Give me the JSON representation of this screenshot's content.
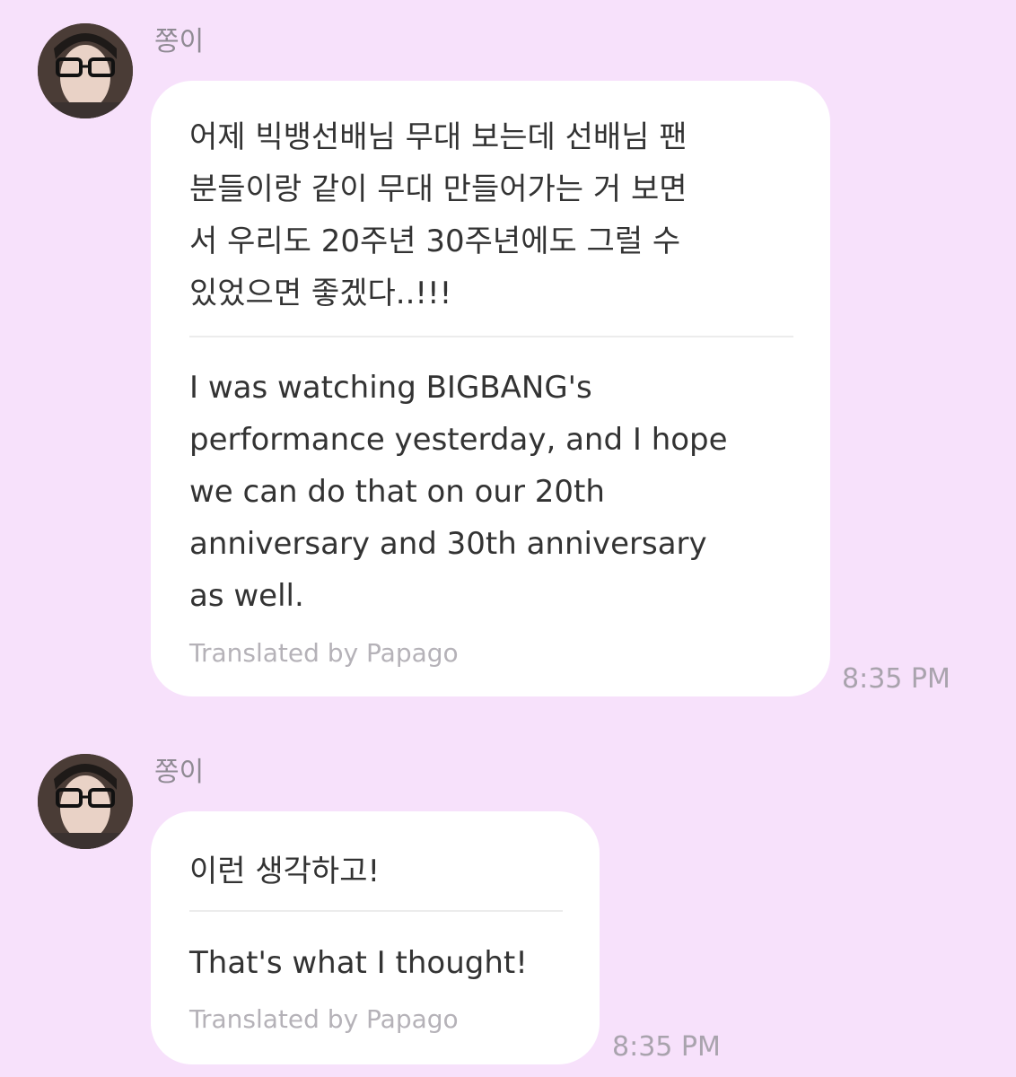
{
  "messages": [
    {
      "sender": "쫑이",
      "korean_lines": [
        "어제 빅뱅선배님 무대 보는데 선배님 팬",
        "분들이랑 같이 무대 만들어가는 거 보면",
        "서 우리도 20주년 30주년에도 그럴 수",
        "있었으면 좋겠다..!!!"
      ],
      "english_lines": [
        "I was watching BIGBANG's",
        "performance yesterday, and I hope",
        "we can do that on our 20th",
        "anniversary and 30th anniversary",
        "as well."
      ],
      "translated_by": "Translated by Papago",
      "time": "8:35 PM"
    },
    {
      "sender": "쫑이",
      "korean_lines": [
        "이런 생각하고!"
      ],
      "english_lines": [
        "That's what I thought!"
      ],
      "translated_by": "Translated by Papago",
      "time": "8:35 PM"
    }
  ]
}
